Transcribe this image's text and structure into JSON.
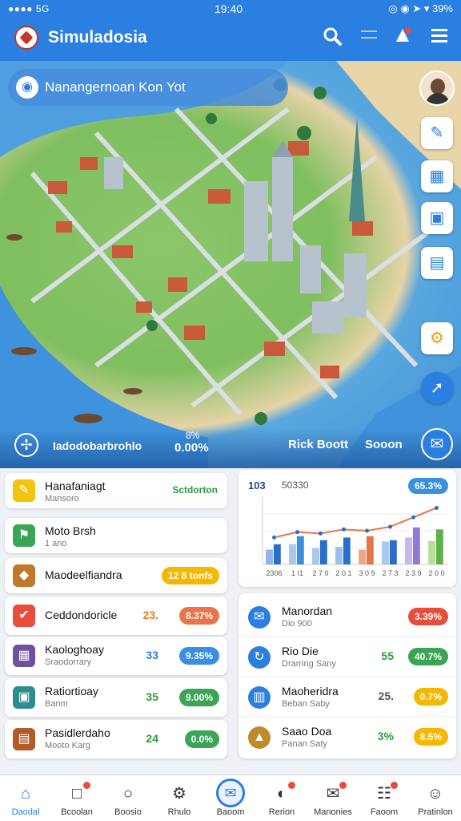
{
  "status": {
    "signal": "●●●● 5G",
    "time": "19:40",
    "right": "◎ ◉ ➤ ▾ 39%"
  },
  "app": {
    "title": "Simuladosia"
  },
  "map": {
    "banner_text": "Nanangernoan Kon Yot",
    "bottom": {
      "left_label": "Iadodobarbrohlo",
      "value_top": "8%",
      "value": "0.00%",
      "label2": "Rick Boott",
      "label3": "Sooon"
    }
  },
  "left_list": [
    {
      "title": "Hanafaniagt",
      "sub": "Mansoro",
      "right": "Sctdorton",
      "right_color": "#2e9b3d",
      "icon_color": "#f1c40f",
      "icon": "✎"
    },
    {
      "title": "Moto Brsh",
      "sub": "1 ano",
      "right": "",
      "right_color": "",
      "icon_color": "#3aa655",
      "icon": "⚑"
    },
    {
      "title": "Maodeelfiandra",
      "sub": "",
      "right": "",
      "pill": "12 8 tonfs",
      "pill_color": "#f5b800",
      "icon_color": "#c0792a",
      "icon": "◆"
    },
    {
      "title": "Ceddondoricle",
      "sub": "",
      "num": "23.",
      "num_color": "#e67e22",
      "pill": "8.37%",
      "pill_color": "#e8754a",
      "icon_color": "#e74c3c",
      "icon": "✔"
    },
    {
      "title": "Kaologhoay",
      "sub": "Sraodorrary",
      "num": "33",
      "num_color": "#2b7fe0",
      "pill": "9.35%",
      "pill_color": "#3b8fe0",
      "icon_color": "#6f4fa0",
      "icon": "▦"
    },
    {
      "title": "Ratiortioay",
      "sub": "Banm",
      "num": "35",
      "num_color": "#2e9b3d",
      "pill": "9.00%",
      "pill_color": "#3aa655",
      "icon_color": "#2e8c8c",
      "icon": "▣"
    },
    {
      "title": "Pasidlerdaho",
      "sub": "Mooto Karg",
      "num": "24",
      "num_color": "#2e9b3d",
      "pill": "0.0%",
      "pill_color": "#3aa655",
      "icon_color": "#b35a2a",
      "icon": "▤"
    }
  ],
  "chart_card": {
    "stat1": "103",
    "stat2": "50330",
    "badge": "65.3%"
  },
  "chart_data": {
    "type": "bar",
    "categories": [
      "2306",
      "1 I1",
      "2 7 0",
      "2 0 1",
      "3 0 9",
      "2 7 3",
      "2 3 9",
      "2 0 0"
    ],
    "series": [
      {
        "values": [
          22,
          30,
          24,
          26,
          22,
          34,
          40,
          35
        ]
      },
      {
        "values": [
          30,
          42,
          36,
          40,
          42,
          36,
          55,
          52
        ]
      }
    ],
    "line_values": [
      40,
      48,
      46,
      52,
      50,
      56,
      70,
      84
    ],
    "ylim": [
      0,
      100
    ]
  },
  "right_list": [
    {
      "title": "Manordan",
      "sub": "Dio 900",
      "num": "",
      "pill": "3.39%",
      "pill_color": "#e74c3c",
      "icon_color": "#2b7fe0",
      "icon": "✉"
    },
    {
      "title": "Rio Die",
      "sub": "Drarring Sany",
      "num": "55",
      "num_color": "#2e9b3d",
      "pill": "40.7%",
      "pill_color": "#3aa655",
      "icon_color": "#2b7fe0",
      "icon": "↻"
    },
    {
      "title": "Maoheridra",
      "sub": "Beban Saby",
      "num": "25.",
      "num_color": "#555",
      "pill": "0.7%",
      "pill_color": "#f5b800",
      "icon_color": "#2b7fe0",
      "icon": "▥"
    },
    {
      "title": "Saao Doa",
      "sub": "Panan Saty",
      "num": "3%",
      "num_color": "#2e9b3d",
      "pill": "8.5%",
      "pill_color": "#f5b800",
      "icon_color": "#c08a2a",
      "icon": "▲"
    }
  ],
  "nav": [
    {
      "label": "Daodal",
      "icon": "⌂",
      "active": true,
      "dot": false
    },
    {
      "label": "Bcoolan",
      "icon": "□",
      "active": false,
      "dot": true
    },
    {
      "label": "Boosio",
      "icon": "○",
      "active": false,
      "dot": false
    },
    {
      "label": "Rhulo",
      "icon": "⚙",
      "active": false,
      "dot": false
    },
    {
      "label": "Baoom",
      "icon": "",
      "active": false,
      "dot": false
    },
    {
      "label": "Rerion",
      "icon": "◐",
      "active": false,
      "dot": true
    },
    {
      "label": "Manonies",
      "icon": "✉",
      "active": false,
      "dot": true
    },
    {
      "label": "Faoom",
      "icon": "☷",
      "active": false,
      "dot": true
    },
    {
      "label": "Pratinlon",
      "icon": "☺",
      "active": false,
      "dot": false
    }
  ],
  "colors": {
    "primary": "#2b7fe0",
    "green": "#3aa655",
    "orange": "#e8754a",
    "yellow": "#f5b800"
  }
}
